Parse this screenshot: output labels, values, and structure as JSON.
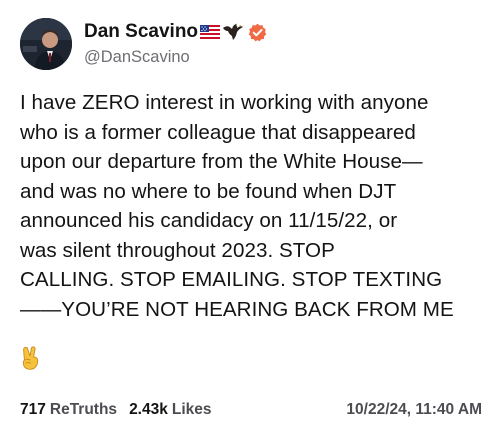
{
  "post": {
    "author": {
      "display_name": "Dan Scavino",
      "handle": "@DanScavino",
      "name_emoji": [
        "us-flag-icon",
        "eagle-icon"
      ],
      "verified": true,
      "verified_color": "#f06a44"
    },
    "body_lines": [
      "I have ZERO interest in working with anyone",
      "who is a former colleague that disappeared",
      "upon our departure from the White House—",
      "and was no where to be found when DJT",
      "announced his candidacy on 11/15/22, or",
      "was silent throughout 2023. STOP",
      "CALLING. STOP EMAILING. STOP TEXTING",
      "——YOU’RE NOT HEARING BACK FROM ME"
    ],
    "trailing_emoji": "victory-hand-icon",
    "stats": {
      "retruths_count": "717",
      "retruths_label": "ReTruths",
      "likes_count": "2.43k",
      "likes_label": "Likes"
    },
    "timestamp": "10/22/24, 11:40 AM"
  }
}
